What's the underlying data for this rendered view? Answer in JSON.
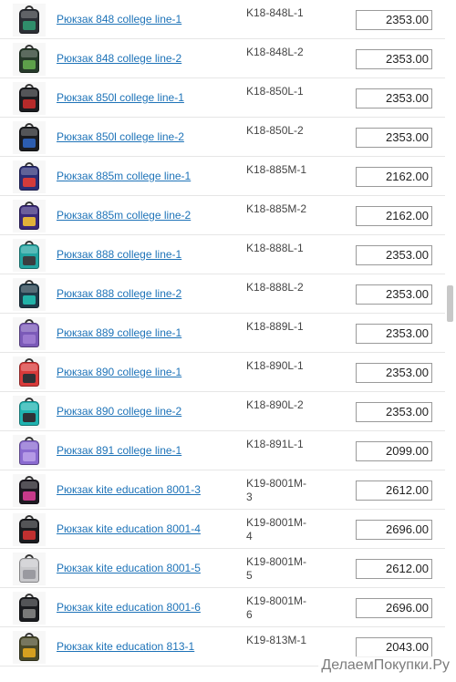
{
  "products": [
    {
      "name": "Рюкзак 848 college line-1",
      "code": "K18-848L-1",
      "price": "2353.00",
      "colors": [
        "#2b2f35",
        "#2f8d6b"
      ]
    },
    {
      "name": "Рюкзак 848 college line-2",
      "code": "K18-848L-2",
      "price": "2353.00",
      "colors": [
        "#263a2a",
        "#5da04a"
      ]
    },
    {
      "name": "Рюкзак 850l college line-1",
      "code": "K18-850L-1",
      "price": "2353.00",
      "colors": [
        "#1b1c20",
        "#b62a2a"
      ]
    },
    {
      "name": "Рюкзак 850l college line-2",
      "code": "K18-850L-2",
      "price": "2353.00",
      "colors": [
        "#1b1c20",
        "#2c5db0"
      ]
    },
    {
      "name": "Рюкзак 885m college line-1",
      "code": "K18-885M-1",
      "price": "2162.00",
      "colors": [
        "#2b2e76",
        "#d43b3b"
      ]
    },
    {
      "name": "Рюкзак 885m college line-2",
      "code": "K18-885M-2",
      "price": "2162.00",
      "colors": [
        "#3a2a7a",
        "#e0b23a"
      ]
    },
    {
      "name": "Рюкзак 888 college line-1",
      "code": "K18-888L-1",
      "price": "2353.00",
      "colors": [
        "#22a3a0",
        "#3a3d40"
      ]
    },
    {
      "name": "Рюкзак 888 college line-2",
      "code": "K18-888L-2",
      "price": "2353.00",
      "colors": [
        "#1f3b4a",
        "#22b3a8"
      ]
    },
    {
      "name": "Рюкзак 889 college line-1",
      "code": "K18-889L-1",
      "price": "2353.00",
      "colors": [
        "#7b5ab8",
        "#9c7ad0"
      ]
    },
    {
      "name": "Рюкзак 890 college line-1",
      "code": "K18-890L-1",
      "price": "2353.00",
      "colors": [
        "#d83a3a",
        "#2f3136"
      ]
    },
    {
      "name": "Рюкзак 890 college line-2",
      "code": "K18-890L-2",
      "price": "2353.00",
      "colors": [
        "#1fb3b0",
        "#2f3136"
      ]
    },
    {
      "name": "Рюкзак 891 college line-1",
      "code": "K18-891L-1",
      "price": "2099.00",
      "colors": [
        "#8a6ad0",
        "#b59ae6"
      ]
    },
    {
      "name": "Рюкзак kite education 8001-3",
      "code": "K19-8001M-3",
      "price": "2612.00",
      "colors": [
        "#1e1a22",
        "#c63a8a"
      ]
    },
    {
      "name": "Рюкзак kite education 8001-4",
      "code": "K19-8001M-4",
      "price": "2696.00",
      "colors": [
        "#1b1c20",
        "#c03030"
      ]
    },
    {
      "name": "Рюкзак kite education 8001-5",
      "code": "K19-8001M-5",
      "price": "2612.00",
      "colors": [
        "#c9c9cc",
        "#9a9aa0"
      ]
    },
    {
      "name": "Рюкзак kite education 8001-6",
      "code": "K19-8001M-6",
      "price": "2696.00",
      "colors": [
        "#1b1c20",
        "#7a7a7a"
      ]
    },
    {
      "name": "Рюкзак kite education 813-1",
      "code": "K19-813M-1",
      "price": "2043.00",
      "colors": [
        "#4a4a2a",
        "#d6a020"
      ]
    }
  ],
  "watermark": "ДелаемПокупки.Ру"
}
